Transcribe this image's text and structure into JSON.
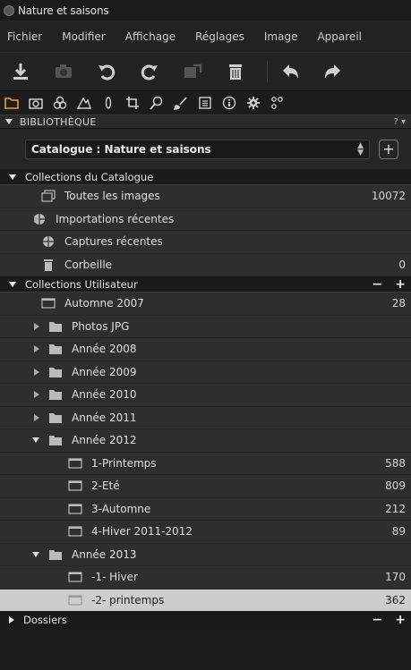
{
  "window": {
    "title": "Nature et saisons"
  },
  "menu": [
    "Fichier",
    "Modifier",
    "Affichage",
    "Réglages",
    "Image",
    "Appareil"
  ],
  "toolbar": [
    "download-icon",
    "camera-icon",
    "rotate-left-icon",
    "rotate-right-icon",
    "move-icon",
    "trash-icon",
    "undo-icon",
    "redo-icon"
  ],
  "tooltabs": [
    "folder-icon",
    "camera-icon",
    "circles-icon",
    "triangle-icon",
    "lens-icon",
    "crop-icon",
    "search-icon",
    "brush-icon",
    "list-icon",
    "info-icon",
    "gear-icon",
    "nodes-icon"
  ],
  "panel": {
    "title": "BIBLIOTHÈQUE",
    "right": "? ▾"
  },
  "catalog": {
    "label": "Catalogue : Nature et saisons",
    "add": "+"
  },
  "sections": {
    "catalog": "Collections du Catalogue",
    "user": "Collections Utilisateur",
    "folders": "Dossiers"
  },
  "catalog_items": [
    {
      "label": "Toutes les images",
      "count": "10072"
    },
    {
      "label": "Importations récentes",
      "count": ""
    },
    {
      "label": "Captures récentes",
      "count": ""
    },
    {
      "label": "Corbeille",
      "count": "0"
    }
  ],
  "user_items": [
    {
      "label": "Automne 2007",
      "count": "28"
    },
    {
      "label": "Photos JPG",
      "count": ""
    },
    {
      "label": "Année 2008",
      "count": ""
    },
    {
      "label": "Année 2009",
      "count": ""
    },
    {
      "label": "Année 2010",
      "count": ""
    },
    {
      "label": "Année 2011",
      "count": ""
    },
    {
      "label": "Année 2012",
      "count": ""
    },
    {
      "label": "1-Printemps",
      "count": "588"
    },
    {
      "label": "2-Eté",
      "count": "809"
    },
    {
      "label": "3-Automne",
      "count": "212"
    },
    {
      "label": "4-Hiver 2011-2012",
      "count": "89"
    },
    {
      "label": "Année 2013",
      "count": ""
    },
    {
      "label": "-1- Hiver",
      "count": "170"
    },
    {
      "label": "-2- printemps",
      "count": "362"
    }
  ],
  "colors": {
    "accent": "#e8a020",
    "selected": "#cdcdcd"
  }
}
